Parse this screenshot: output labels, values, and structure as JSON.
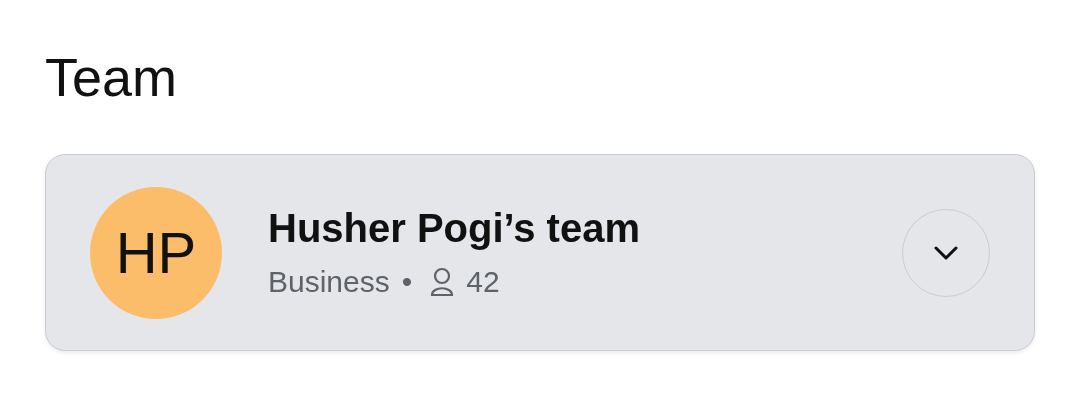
{
  "title": "Team",
  "team": {
    "initials": "HP",
    "name": "Husher Pogi’s team",
    "plan": "Business",
    "separator": "•",
    "member_count": "42",
    "expanded": false
  }
}
